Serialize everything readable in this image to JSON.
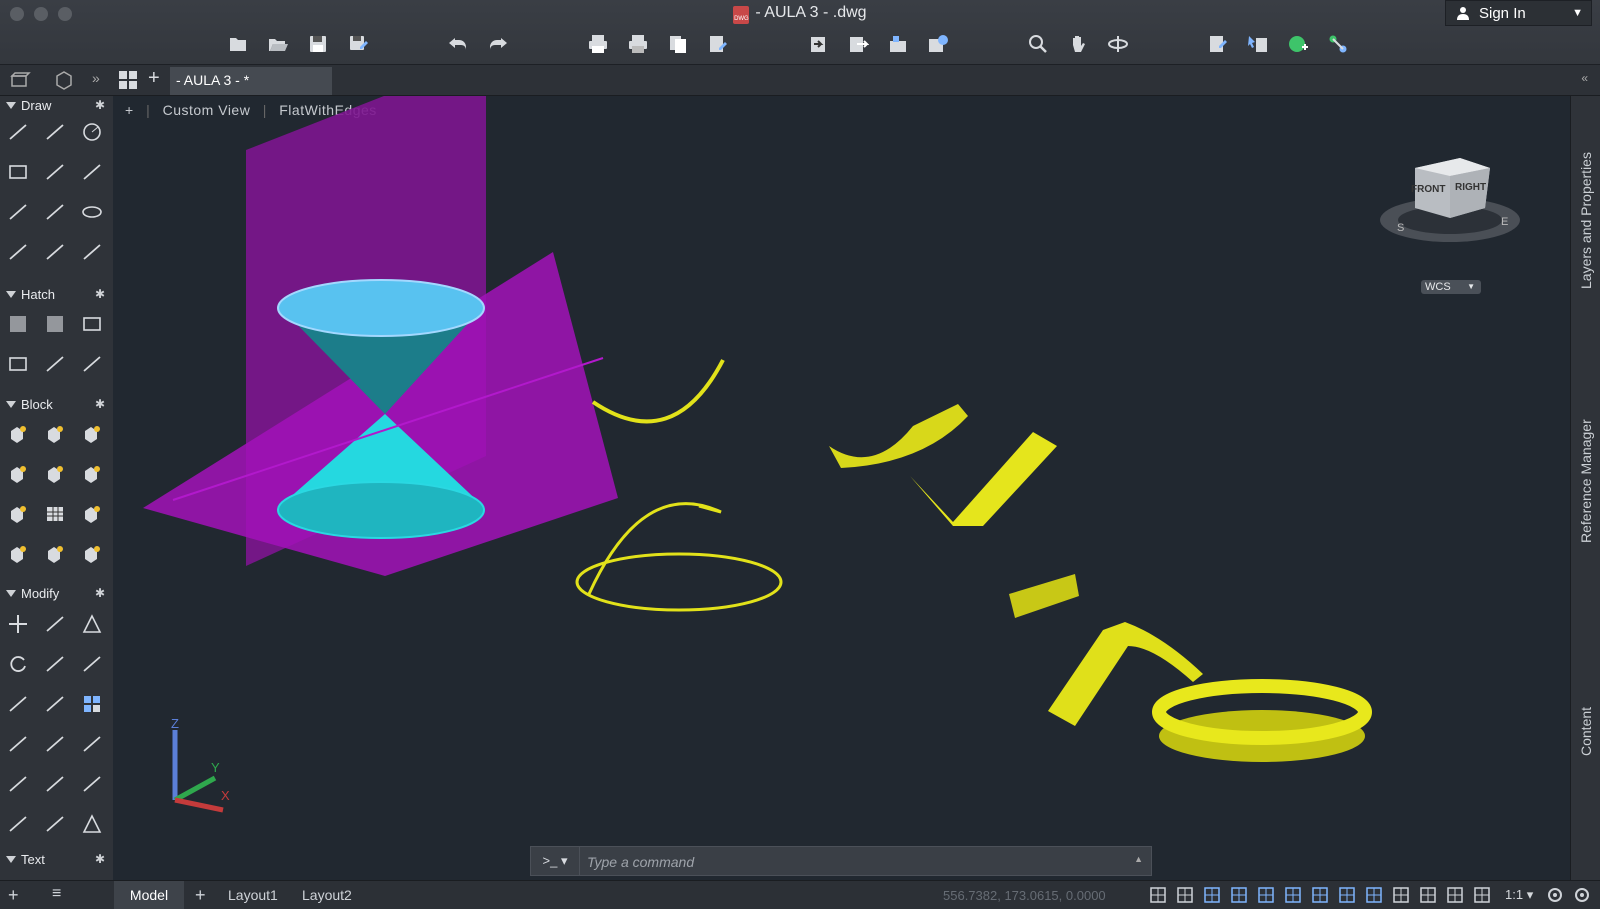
{
  "window": {
    "title": "- AULA 3 - .dwg",
    "file_icon_label": "DWG",
    "sign_in": "Sign In"
  },
  "tabs": {
    "active": "- AULA 3 - *"
  },
  "viewport": {
    "view_control": "+",
    "view_name": "Custom View",
    "visual_style": "FlatWithEdges",
    "viewcube": {
      "front": "FRONT",
      "right": "RIGHT",
      "compass_s": "S",
      "compass_e": "E"
    },
    "wcs": "WCS",
    "ucs": {
      "z": "Z",
      "y": "Y",
      "x": "X"
    }
  },
  "palette": {
    "sections": [
      {
        "name": "Draw"
      },
      {
        "name": "Hatch"
      },
      {
        "name": "Block"
      },
      {
        "name": "Modify"
      },
      {
        "name": "Text"
      }
    ]
  },
  "right_panel": {
    "tabs": [
      "Layers and Properties",
      "Reference Manager",
      "Content"
    ]
  },
  "command_line": {
    "prompt": ">_",
    "placeholder": "Type a command"
  },
  "status_bar": {
    "layout_tabs": [
      "Model",
      "Layout1",
      "Layout2"
    ],
    "coordinates": "556.7382, 173.0615, 0.0000",
    "annotation_scale": "1:1"
  },
  "colors": {
    "viewport_bg": "#212830",
    "plane_magenta": "#a212b8",
    "cone_cyan": "#25d8e0",
    "curve_yellow": "#e2e21a"
  }
}
